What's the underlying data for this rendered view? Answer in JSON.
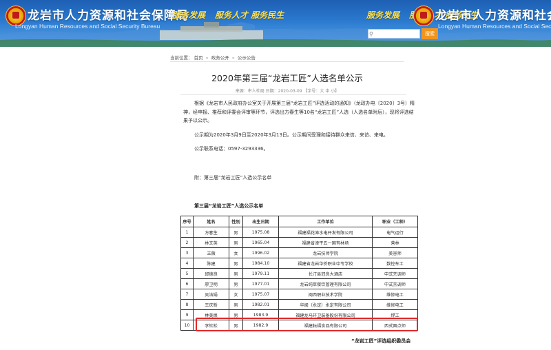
{
  "header": {
    "site_title": "龙岩市人力资源和社会保障局",
    "site_subtitle": "Longyan Human Resources and Social Security Bureau",
    "slogan_left": "服务发展",
    "slogan_right": "服务人才 服务民生",
    "search_placeholder": "",
    "search_button": "搜索",
    "colors": {
      "banner": "#2b7ad0",
      "slogan": "#ffe04a",
      "search_button": "#f3941c"
    }
  },
  "breadcrumb": {
    "prefix": "当前位置：",
    "items": [
      "首页",
      "政务公开",
      "公示公告"
    ],
    "separator": "»"
  },
  "article": {
    "title": "2020年第三届“龙岩工匠”人选名单公示",
    "meta": "来源：市人社局  日期：2020-03-09  【字号：大 中 小】",
    "paragraph1": "根据《龙岩市人民政府办公室关于开展第三届“龙岩工匠”评选活动的通知》（龙政办电〔2020〕3号）精神，经申报、推荐和评委会评审等环节，评选出方春生等10名“龙岩工匠”人选（人选名单附后），现将评选结果予以公示。",
    "paragraph2": "公示期为2020年3月9日至2020年3月13日。公示期间受理和接待群众来信、来访、来电。",
    "paragraph3": "公示联系电话：0597-3293336。",
    "attachment": "附：第三届“龙岩工匠”人选公示名单",
    "table_title": "第三届“龙岩工匠”人选公示名单",
    "table_headers": [
      "序号",
      "姓名",
      "性别",
      "出生日期",
      "工作单位",
      "职业（工种）"
    ],
    "rows": [
      [
        "1",
        "方春生",
        "男",
        "1975.08",
        "福建福花滩水电开发有限公司",
        "电气运行"
      ],
      [
        "2",
        "林文英",
        "男",
        "1965.04",
        "福建省漳平五一国有林场",
        "营林"
      ],
      [
        "3",
        "王薇",
        "女",
        "1996.02",
        "龙岩技师学院",
        "美容师"
      ],
      [
        "4",
        "陈建",
        "男",
        "1984.10",
        "福建省龙岩华侨职业中专学校",
        "数控车工"
      ],
      [
        "5",
        "邱德良",
        "男",
        "1979.11",
        "长汀县冠良大酒店",
        "中式烹调师"
      ],
      [
        "6",
        "廖卫明",
        "男",
        "1977.01",
        "龙岩纯萃餐饮管理有限公司",
        "中式烹调师"
      ],
      [
        "7",
        "吴洁娟",
        "女",
        "1975.07",
        "闽西职业技术学院",
        "维修电工"
      ],
      [
        "8",
        "王庆新",
        "男",
        "1982.01",
        "华闽（永定）永定有限公司",
        "维修电工"
      ],
      [
        "9",
        "林美焕",
        "男",
        "1983.9",
        "福建龙马环卫装备股份有限公司",
        "焊工"
      ],
      [
        "10",
        "李钦松",
        "男",
        "1982.9",
        "福建耘福食品有限公司",
        "西式面点师"
      ]
    ],
    "signature": "“龙岩工匠”评选组织委员会"
  }
}
